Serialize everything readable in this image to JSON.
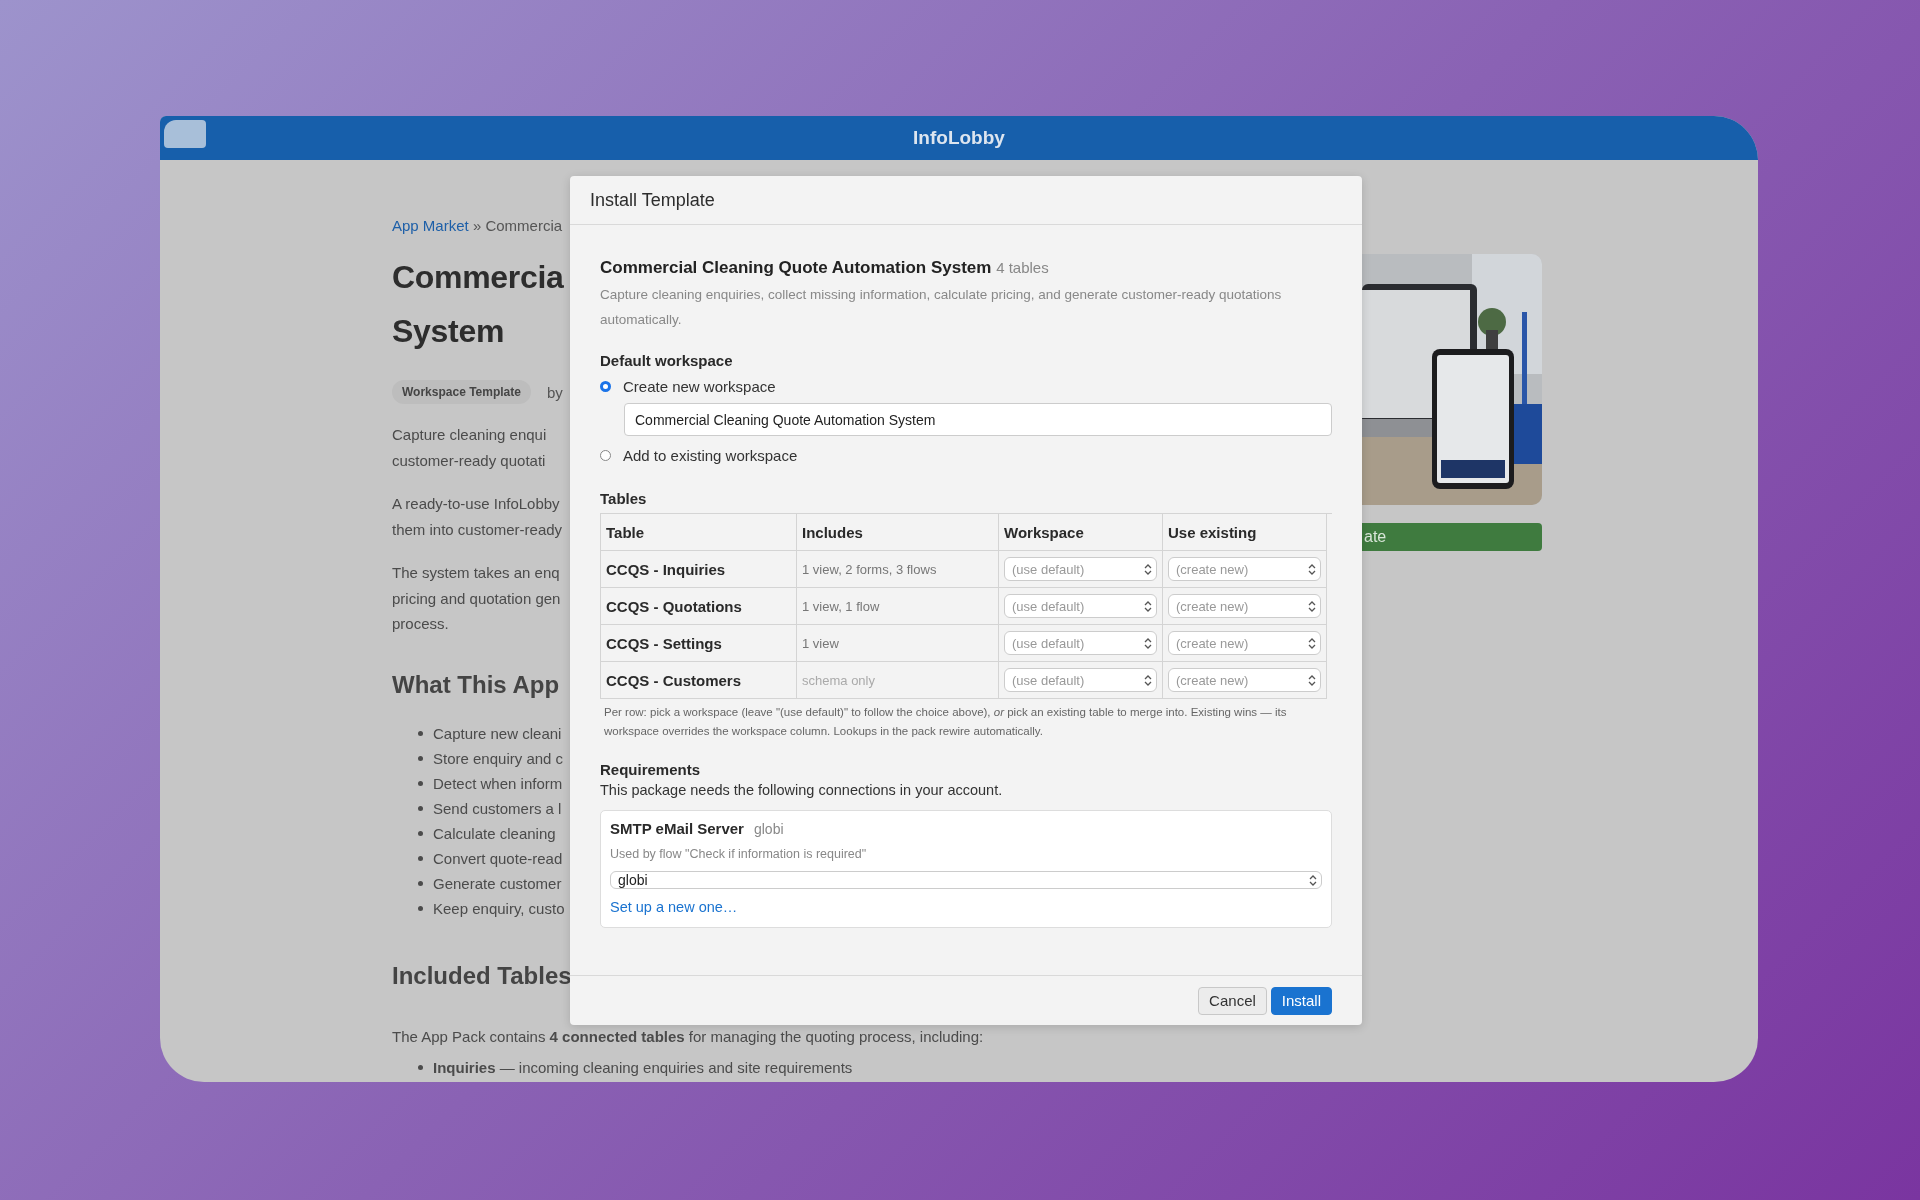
{
  "browser": {
    "title": "InfoLobby"
  },
  "page": {
    "breadcrumb": {
      "link": "App Market",
      "rest": "» Commercia"
    },
    "title_lines": [
      "Commercia",
      "System"
    ],
    "badge": "Workspace Template",
    "byline": "by",
    "paragraphs": [
      [
        "Capture cleaning enqui",
        "customer-ready quotati"
      ],
      [
        "A ready-to-use InfoLobby",
        "them into customer-ready"
      ],
      [
        "The system takes an enq",
        "pricing and quotation gen",
        "process."
      ]
    ],
    "section_1": "What This App",
    "bullets": [
      "Capture new cleani",
      "Store enquiry and c",
      "Detect when inform",
      "Send customers a l",
      "Calculate cleaning",
      "Convert quote-read",
      "Generate customer",
      "Keep enquiry, custo"
    ],
    "section_2": "Included Tables",
    "intro": "The App Pack contains **4 connected tables** for managing the quoting process, including:",
    "table_list": [
      "**Inquiries** — incoming cleaning enquiries and site requirements"
    ],
    "side": {
      "button": "ate"
    }
  },
  "dialog": {
    "title": "Install Template",
    "package": {
      "name": "Commercial Cleaning Quote Automation System",
      "count": "4 tables",
      "description": "Capture cleaning enquiries, collect missing information, calculate pricing, and generate customer-ready quotations automatically."
    },
    "workspace": {
      "label": "Default workspace",
      "name_value": "Commercial Cleaning Quote Automation System",
      "options": [
        {
          "label": "Create new workspace",
          "selected": true
        },
        {
          "label": "Add to existing workspace",
          "selected": false
        }
      ]
    },
    "tables": {
      "label": "Tables",
      "columns": [
        "Table",
        "Includes",
        "Workspace",
        "Use existing"
      ],
      "rows": [
        {
          "name": "CCQS - Inquiries",
          "includes": "1 view, 2 forms, 3 flows",
          "muted": false,
          "workspace": "(use default)",
          "existing": "(create new)"
        },
        {
          "name": "CCQS - Quotations",
          "includes": "1 view, 1 flow",
          "muted": false,
          "workspace": "(use default)",
          "existing": "(create new)"
        },
        {
          "name": "CCQS - Settings",
          "includes": "1 view",
          "muted": false,
          "workspace": "(use default)",
          "existing": "(create new)"
        },
        {
          "name": "CCQS - Customers",
          "includes": "schema only",
          "muted": true,
          "workspace": "(use default)",
          "existing": "(create new)"
        }
      ],
      "note": "Per row: pick a workspace (leave \"(use default)\" to follow the choice above), *or* pick an existing table to merge into. Existing wins — its workspace overrides the workspace column. Lookups in the pack rewire automatically."
    },
    "requirements": {
      "label": "Requirements",
      "intro": "This package needs the following connections in your account.",
      "items": [
        {
          "name": "SMTP eMail Server",
          "account": "globi",
          "used_by": "Used by flow \"Check if information is required\"",
          "value": "globi",
          "link": "Set up a new one…"
        }
      ]
    },
    "buttons": [
      {
        "label": "Cancel",
        "kind": "secondary"
      },
      {
        "label": "Install",
        "kind": "primary"
      }
    ]
  }
}
